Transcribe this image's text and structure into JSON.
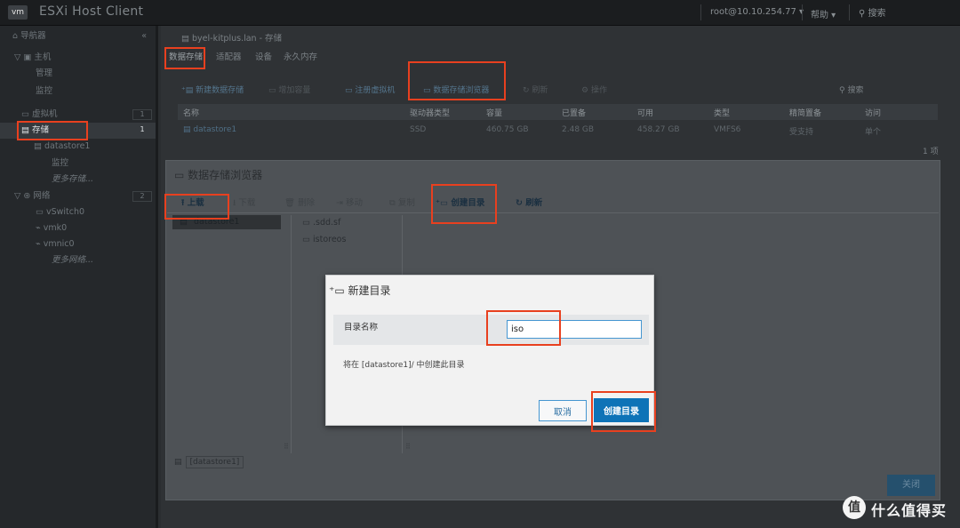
{
  "header": {
    "logo": "vm",
    "title": "ESXi Host Client",
    "user": "root@10.10.254.77 ▾",
    "help": "帮助 ▾",
    "search": "搜索"
  },
  "navigator": {
    "title": "导航器",
    "collapse": "«",
    "items": [
      {
        "label": "主机",
        "icon": "▽ ▣"
      },
      {
        "label": "管理"
      },
      {
        "label": "监控"
      },
      {
        "label": "虚拟机",
        "badge": "1"
      },
      {
        "label": "存储",
        "badge": "1"
      },
      {
        "label": "datastore1"
      },
      {
        "label": "监控"
      },
      {
        "label": "更多存储..."
      },
      {
        "label": "网络",
        "badge": "2"
      },
      {
        "label": "vSwitch0"
      },
      {
        "label": "vmk0"
      },
      {
        "label": "vmnic0"
      },
      {
        "label": "更多网络..."
      }
    ]
  },
  "main": {
    "breadcrumb": "byel-kitplus.lan - 存储",
    "tabs": [
      "数据存储",
      "适配器",
      "设备",
      "永久内存"
    ],
    "toolbar": [
      "新建数据存储",
      "增加容量",
      "注册虚拟机",
      "数据存储浏览器",
      "刷新",
      "操作"
    ],
    "search": "搜索",
    "columns": [
      "名称",
      "驱动器类型",
      "容量",
      "已置备",
      "可用",
      "类型",
      "精简置备",
      "访问"
    ],
    "row": [
      "datastore1",
      "SSD",
      "460.75 GB",
      "2.48 GB",
      "458.27 GB",
      "VMFS6",
      "受支持",
      "单个"
    ],
    "count": "1 项"
  },
  "browser": {
    "title": "数据存储浏览器",
    "toolbar": [
      "上载",
      "下载",
      "删除",
      "移动",
      "复制",
      "创建目录",
      "刷新"
    ],
    "datastore": "datastore1",
    "folders": [
      ".sdd.sf",
      "istoreos"
    ],
    "path": "[datastore1]",
    "close": "关闭"
  },
  "dialog": {
    "title": "新建目录",
    "label": "目录名称",
    "value": "iso",
    "hint": "将在 [datastore1]/ 中创建此目录",
    "cancel": "取消",
    "create": "创建目录"
  },
  "watermark": {
    "badge": "值",
    "text": "什么值得买"
  }
}
